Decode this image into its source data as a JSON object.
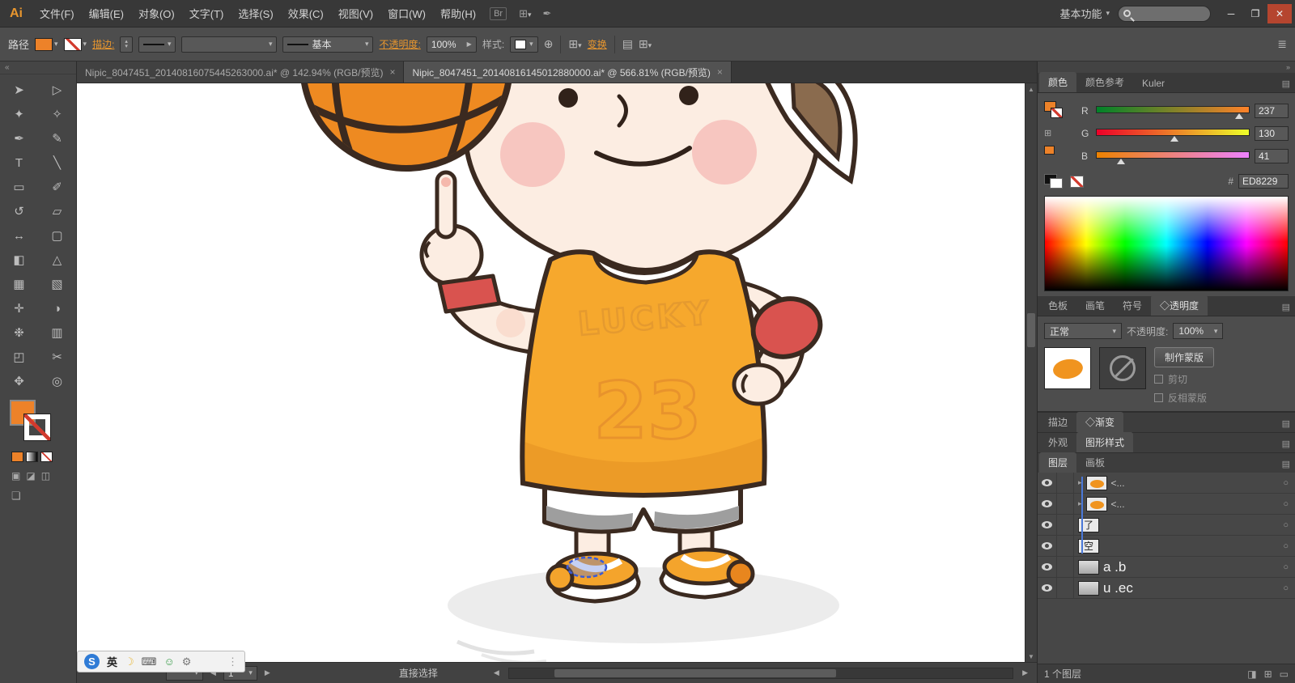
{
  "colors": {
    "accent": "#E8962E",
    "current_fill": "#ED8229"
  },
  "icons": {
    "dropdown": "▾",
    "spin_up": "▴",
    "spin_down": "▾",
    "minimize": "─",
    "restore": "❐",
    "close": "✕",
    "grid": "⊞",
    "feather": "✒",
    "globe": "⊕",
    "panel_menu": "▤",
    "hamburger": "≣",
    "arrow_left": "◀",
    "arrow_right": "▶",
    "arrow_up": "▲",
    "arrow_down": "▼",
    "collapse_left": "«",
    "collapse_right": "»",
    "target": "○",
    "chevron": "▸",
    "moon": "☽",
    "keyboard": "⌨",
    "person": "☺",
    "wrench": "⚙",
    "new_sublayer": "◨",
    "new_layer": "⊞",
    "delete_layer": "▭",
    "grip": "⋮"
  },
  "window": {
    "logo": "Ai",
    "bridge_label": "Br",
    "workspace_label": "基本功能"
  },
  "menus": [
    "文件(F)",
    "编辑(E)",
    "对象(O)",
    "文字(T)",
    "选择(S)",
    "效果(C)",
    "视图(V)",
    "窗口(W)",
    "帮助(H)"
  ],
  "control_bar": {
    "context": "路径",
    "stroke_link": "描边:",
    "line_style_value": "基本",
    "opacity_label": "不透明度:",
    "opacity_value": "100%",
    "style_label": "样式:",
    "transform_link": "变换"
  },
  "doc_tabs": [
    {
      "title": "Nipic_8047451_20140816075445263000.ai* @ 142.94% (RGB/预览)",
      "close": "×",
      "active": false
    },
    {
      "title": "Nipic_8047451_20140816145012880000.ai* @ 566.81% (RGB/预览)",
      "close": "×",
      "active": true
    }
  ],
  "tools": [
    {
      "name": "selection-tool",
      "glyph": "➤"
    },
    {
      "name": "direct-selection-tool",
      "glyph": "▷"
    },
    {
      "name": "magic-wand-tool",
      "glyph": "✦"
    },
    {
      "name": "lasso-tool",
      "glyph": "✧"
    },
    {
      "name": "pen-tool",
      "glyph": "✒"
    },
    {
      "name": "pencil-tool",
      "glyph": "✎"
    },
    {
      "name": "type-tool",
      "glyph": "T"
    },
    {
      "name": "line-segment-tool",
      "glyph": "╲"
    },
    {
      "name": "rectangle-tool",
      "glyph": "▭"
    },
    {
      "name": "paintbrush-tool",
      "glyph": "✐"
    },
    {
      "name": "rotate-tool",
      "glyph": "↺"
    },
    {
      "name": "scale-tool",
      "glyph": "▱"
    },
    {
      "name": "width-tool",
      "glyph": "↔"
    },
    {
      "name": "free-transform-tool",
      "glyph": "▢"
    },
    {
      "name": "shape-builder-tool",
      "glyph": "◧"
    },
    {
      "name": "perspective-grid-tool",
      "glyph": "△"
    },
    {
      "name": "mesh-tool",
      "glyph": "▦"
    },
    {
      "name": "gradient-tool",
      "glyph": "▧"
    },
    {
      "name": "eyedropper-tool",
      "glyph": "✛"
    },
    {
      "name": "blend-tool",
      "glyph": "◑"
    },
    {
      "name": "symbol-sprayer-tool",
      "glyph": "❉"
    },
    {
      "name": "column-graph-tool",
      "glyph": "▥"
    },
    {
      "name": "artboard-tool",
      "glyph": "◰"
    },
    {
      "name": "slice-tool",
      "glyph": "✂"
    },
    {
      "name": "hand-tool",
      "glyph": "✥"
    },
    {
      "name": "zoom-tool",
      "glyph": "◎"
    }
  ],
  "toolbar_extras": {
    "draw_modes": [
      "▣",
      "◪",
      "◫"
    ],
    "screen_mode": "❏"
  },
  "artwork": {
    "jersey_text": "LUCKY",
    "jersey_number": "23"
  },
  "color_panel": {
    "tabs": [
      {
        "label": "颜色",
        "active": true
      },
      {
        "label": "颜色参考",
        "active": false
      },
      {
        "label": "Kuler",
        "active": false
      }
    ],
    "channels": [
      {
        "label": "R",
        "value": 237,
        "from": "rgb(0,130,41)",
        "to": "rgb(255,130,41)"
      },
      {
        "label": "G",
        "value": 130,
        "from": "rgb(237,0,41)",
        "to": "rgb(237,255,41)"
      },
      {
        "label": "B",
        "value": 41,
        "from": "rgb(237,130,0)",
        "to": "rgb(237,130,255)"
      }
    ],
    "hex_prefix": "#",
    "hex_value": "ED8229"
  },
  "panel_group": {
    "tabs": [
      {
        "label": "色板",
        "active": false
      },
      {
        "label": "画笔",
        "active": false
      },
      {
        "label": "符号",
        "active": false
      },
      {
        "label": "◇透明度",
        "active": true
      }
    ]
  },
  "transparency": {
    "blend_mode": "正常",
    "opacity_label": "不透明度:",
    "opacity_value": "100%",
    "make_mask_button": "制作蒙版",
    "clip_label": "剪切",
    "invert_label": "反相蒙版"
  },
  "collapsed_panels": [
    {
      "tabs": [
        {
          "label": "描边",
          "active": false
        },
        {
          "label": "◇渐变",
          "active": true
        }
      ]
    },
    {
      "tabs": [
        {
          "label": "外观",
          "active": false
        },
        {
          "label": "图形样式",
          "active": true
        }
      ]
    },
    {
      "tabs": [
        {
          "label": "图层",
          "active": true
        },
        {
          "label": "画板",
          "active": false
        }
      ]
    }
  ],
  "layers_panel": {
    "rows": [
      {
        "label": "<...",
        "thumb": "art",
        "big": false,
        "expander": true
      },
      {
        "label": "<...",
        "thumb": "art",
        "big": false,
        "expander": true
      },
      {
        "label": "",
        "thumb": "了",
        "big": false,
        "expander": false
      },
      {
        "label": "",
        "thumb": "空",
        "big": false,
        "expander": false
      },
      {
        "label": "a .b",
        "thumb": "img",
        "big": true,
        "expander": false
      },
      {
        "label": "u .ec",
        "thumb": "img",
        "big": true,
        "expander": false
      }
    ],
    "status": "1 个图层"
  },
  "status_bar": {
    "artboard_value": "1",
    "tool_status": "直接选择"
  },
  "language_bar": {
    "logo": "S",
    "lang": "英"
  }
}
